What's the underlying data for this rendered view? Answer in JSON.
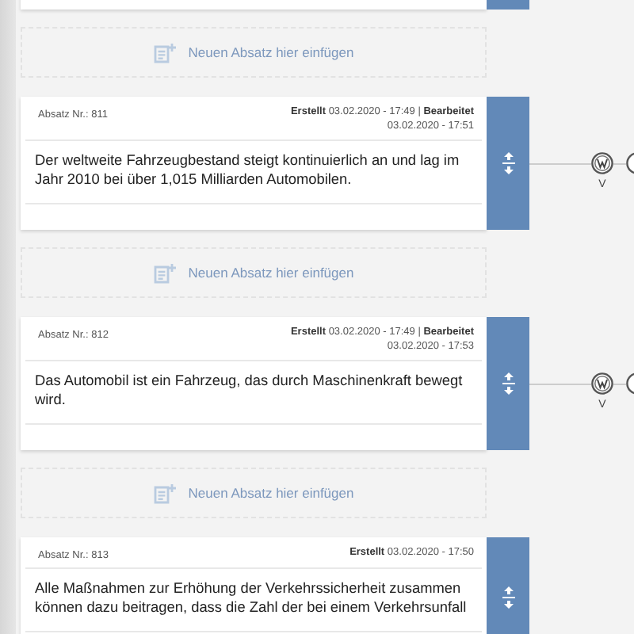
{
  "paragraphs": [
    {
      "insert_label": "Neuen Absatz hier einfügen",
      "number": "Absatz Nr.: 811",
      "meta": "**Erstellt** 03.02.2020 - 17:49 | **Bearbeitet** 03.02.2020 - 17:51",
      "text": "Der weltweite Fahrzeugbestand steigt kontinuierlich an und lag im Jahr 2010 bei über 1,015 Milliarden Automobilen.",
      "node_label": "V"
    },
    {
      "insert_label": "Neuen Absatz hier einfügen",
      "number": "Absatz Nr.: 812",
      "meta": "**Erstellt** 03.02.2020 - 17:49 | **Bearbeitet** 03.02.2020 - 17:53",
      "text": "Das Automobil ist ein Fahrzeug, das durch Maschinenkraft bewegt wird.",
      "node_label": "V"
    },
    {
      "insert_label": "Neuen Absatz hier einfügen",
      "number": "Absatz Nr.: 813",
      "meta": "**Erstellt** 03.02.2020 - 17:50",
      "text": "Alle Maßnahmen zur Erhöhung der Verkehrssicherheit zusammen können dazu beitragen, dass die Zahl der bei einem Verkehrsunfall"
    }
  ]
}
